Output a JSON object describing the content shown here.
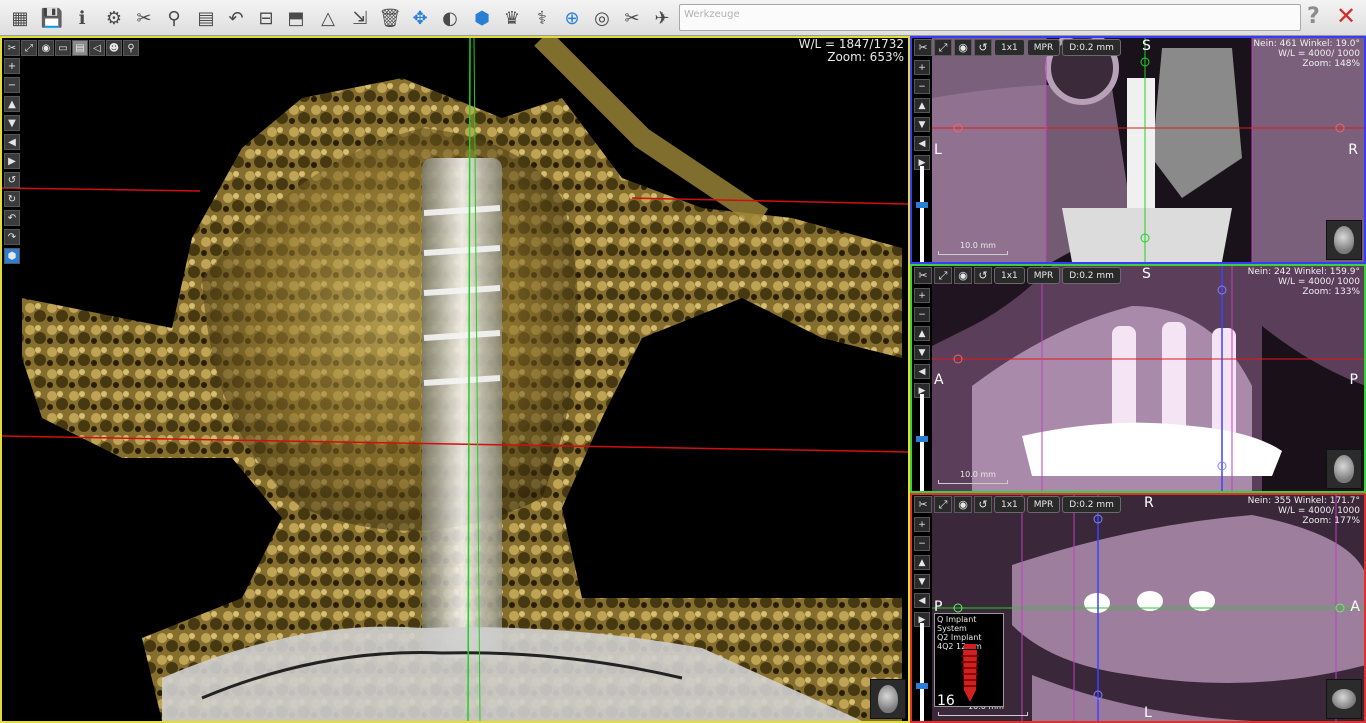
{
  "toolbar": {
    "search_placeholder": "Werkzeuge",
    "help_label": "?",
    "close_label": "✕",
    "buttons": [
      {
        "name": "layout-icon",
        "glyph": "▦"
      },
      {
        "name": "save-icon",
        "glyph": "💾"
      },
      {
        "name": "info-icon",
        "glyph": "ℹ"
      },
      {
        "name": "settings-icon",
        "glyph": "⚙"
      },
      {
        "name": "tools-icon",
        "glyph": "✂"
      },
      {
        "name": "implant-icon",
        "glyph": "⚲"
      },
      {
        "name": "report-icon",
        "glyph": "▤"
      },
      {
        "name": "undo-icon",
        "glyph": "↶"
      },
      {
        "name": "panorama-icon",
        "glyph": "⊟"
      },
      {
        "name": "screen-icon",
        "glyph": "⬒"
      },
      {
        "name": "measure-icon",
        "glyph": "△"
      },
      {
        "name": "export-icon",
        "glyph": "⇲"
      },
      {
        "name": "delete-icon",
        "glyph": "🗑"
      },
      {
        "name": "axis-icon",
        "glyph": "✥"
      },
      {
        "name": "contrast-icon",
        "glyph": "◐"
      },
      {
        "name": "volume-icon",
        "glyph": "⬢"
      },
      {
        "name": "dental-arch-icon",
        "glyph": "♛"
      },
      {
        "name": "nerve-icon",
        "glyph": "⚕"
      },
      {
        "name": "crosshair-icon",
        "glyph": "⊕"
      },
      {
        "name": "scan-icon",
        "glyph": "◎"
      },
      {
        "name": "cut-icon",
        "glyph": "✂"
      },
      {
        "name": "airway-icon",
        "glyph": "✈"
      }
    ]
  },
  "view3d": {
    "wl": "W/L = 1847/1732",
    "zoom": "Zoom: 653%"
  },
  "axial": {
    "info_line1": "Nein: 461 Winkel: 19.0°",
    "info_line2": "W/L = 4000/ 1000",
    "info_line3": "Zoom: 148%",
    "top": "S",
    "left": "L",
    "right": "R",
    "scale": "10.0 mm",
    "layout_btn": "1x1",
    "mpr_btn": "MPR",
    "d_btn": "D:0.2 mm"
  },
  "sagittal": {
    "info_line1": "Nein: 242 Winkel: 159.9°",
    "info_line2": "W/L = 4000/ 1000",
    "info_line3": "Zoom: 133%",
    "top": "S",
    "left": "A",
    "right": "P",
    "scale": "10.0 mm",
    "layout_btn": "1x1",
    "mpr_btn": "MPR",
    "d_btn": "D:0.2 mm"
  },
  "coronal": {
    "info_line1": "Nein: 355 Winkel: 171.7°",
    "info_line2": "W/L = 4000/ 1000",
    "info_line3": "Zoom: 177%",
    "top": "R",
    "bottom": "L",
    "left": "P",
    "right": "A",
    "scale": "10.0 mm",
    "layout_btn": "1x1",
    "mpr_btn": "MPR",
    "d_btn": "D:0.2 mm",
    "implant": {
      "system": "Q Implant System",
      "type": "Q2 Implant",
      "size": "4Q2 12mm",
      "tooth": "16"
    }
  },
  "colors": {
    "active_viewport": "#e2dc3a",
    "axial_frame": "#3a3aff",
    "sagittal_frame": "#3ad23a",
    "coronal_frame": "#e03030",
    "accent": "#2a7fd4"
  }
}
